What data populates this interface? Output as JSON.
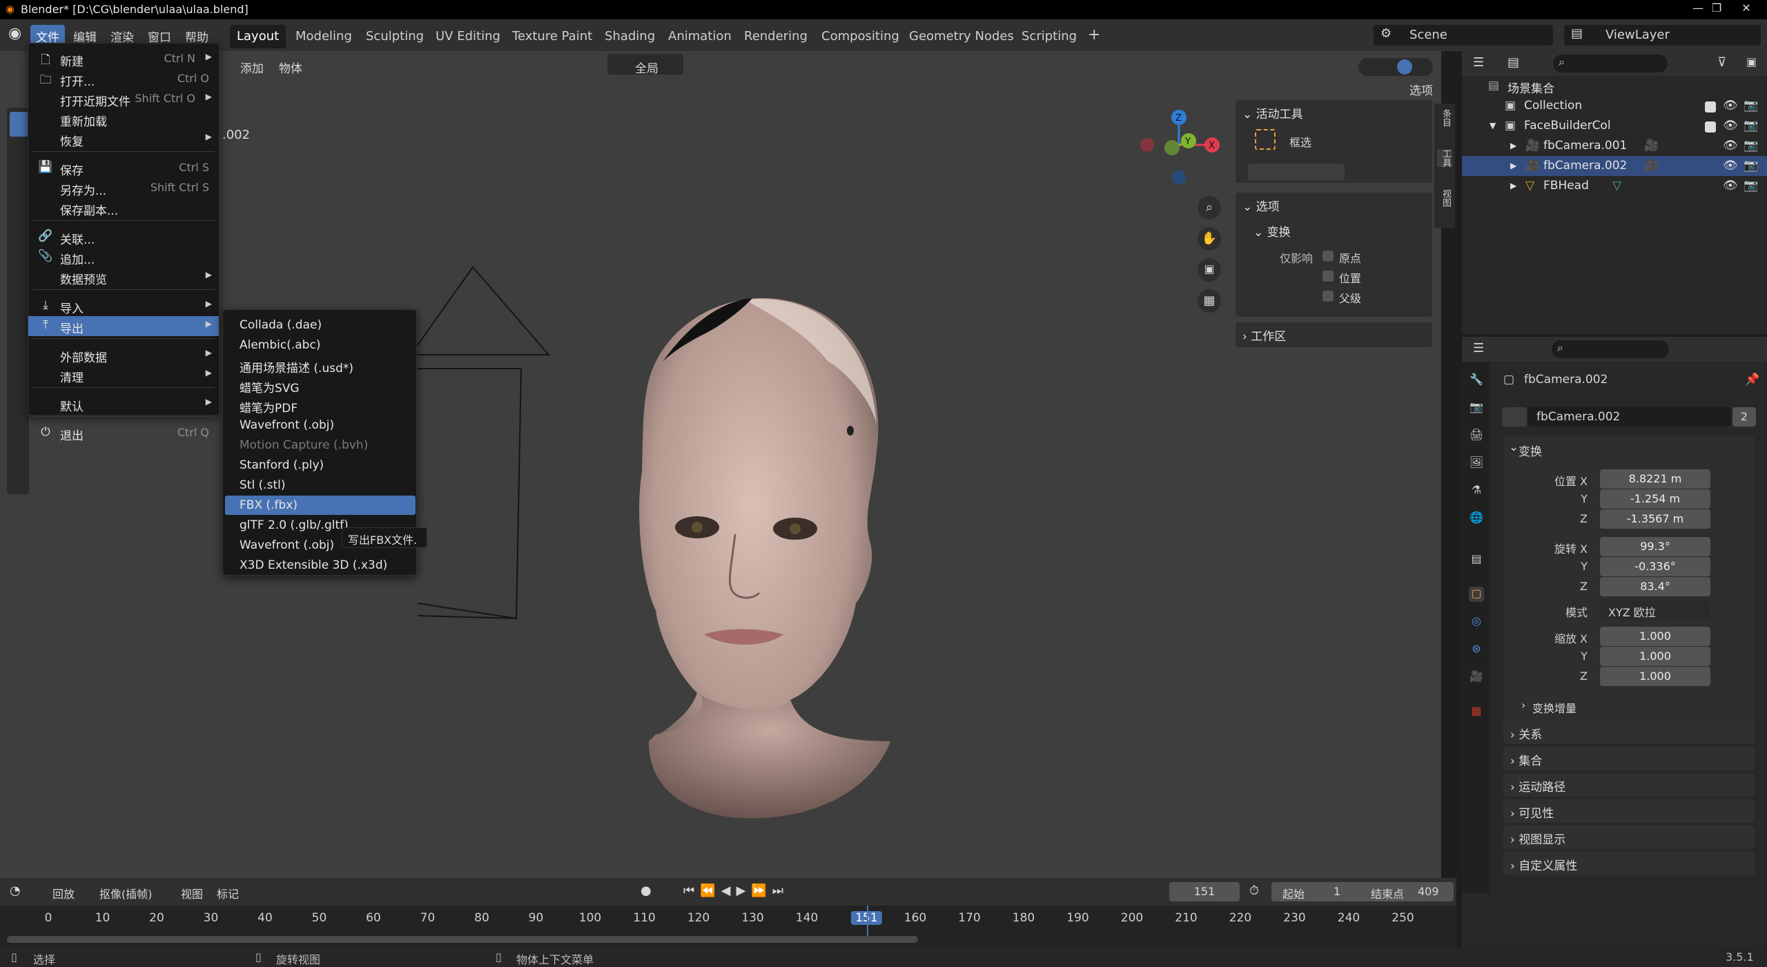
{
  "window": {
    "title": "Blender* [D:\\CG\\blender\\ulaa\\ulaa.blend]",
    "minimize": "—",
    "maximize": "❐",
    "close": "✕"
  },
  "topmenu": [
    "文件",
    "编辑",
    "渲染",
    "窗口",
    "帮助"
  ],
  "workspaces": [
    "Layout",
    "Modeling",
    "Sculpting",
    "UV Editing",
    "Texture Paint",
    "Shading",
    "Animation",
    "Rendering",
    "Compositing",
    "Geometry Nodes",
    "Scripting"
  ],
  "add_workspace": "+",
  "scene": {
    "label": "Scene",
    "viewlayer": "ViewLayer"
  },
  "viewport_header": {
    "add": "添加",
    "object": "物体",
    "transform_orient": "全局",
    "options": "选项",
    "object_label": ".002"
  },
  "gizmo": {
    "z": "Z",
    "y": "Y",
    "x": "X"
  },
  "file_menu": [
    {
      "label": "新建",
      "shortcut": "Ctrl N",
      "icon": "new-file-icon",
      "submenu": true
    },
    {
      "label": "打开...",
      "shortcut": "Ctrl O",
      "icon": "folder-icon"
    },
    {
      "label": "打开近期文件",
      "shortcut": "Shift Ctrl O",
      "icon": "",
      "submenu": true
    },
    {
      "label": "重新加载",
      "shortcut": "",
      "icon": ""
    },
    {
      "label": "恢复",
      "shortcut": "",
      "icon": "",
      "submenu": true
    },
    {
      "label": "保存",
      "shortcut": "Ctrl S",
      "icon": "save-icon"
    },
    {
      "label": "另存为...",
      "shortcut": "Shift Ctrl S",
      "icon": ""
    },
    {
      "label": "保存副本...",
      "shortcut": "",
      "icon": ""
    },
    {
      "label": "关联...",
      "shortcut": "",
      "icon": "link-icon"
    },
    {
      "label": "追加...",
      "shortcut": "",
      "icon": "append-icon"
    },
    {
      "label": "数据预览",
      "shortcut": "",
      "icon": "",
      "submenu": true
    },
    {
      "label": "导入",
      "shortcut": "",
      "icon": "import-icon",
      "submenu": true
    },
    {
      "label": "导出",
      "shortcut": "",
      "icon": "export-icon",
      "submenu": true
    },
    {
      "label": "外部数据",
      "shortcut": "",
      "icon": "",
      "submenu": true
    },
    {
      "label": "清理",
      "shortcut": "",
      "icon": "",
      "submenu": true
    },
    {
      "label": "默认",
      "shortcut": "",
      "icon": "",
      "submenu": true
    },
    {
      "label": "退出",
      "shortcut": "Ctrl Q",
      "icon": "power-icon"
    }
  ],
  "export_menu": [
    "Collada (.dae)",
    "Alembic(.abc)",
    "通用场景描述 (.usd*)",
    "蜡笔为SVG",
    "蜡笔为PDF",
    "Wavefront (.obj)",
    "Motion Capture (.bvh)",
    "Stanford (.ply)",
    "Stl (.stl)",
    "FBX (.fbx)",
    "glTF 2.0 (.glb/.gltf)",
    "Wavefront (.obj)",
    "X3D Extensible 3D (.x3d)"
  ],
  "tooltip": "写出FBX文件.",
  "npanel": {
    "active_tool": "活动工具",
    "tool_name": "框选",
    "options": "选项",
    "transform": "变换",
    "affect_only": "仅影响",
    "origins": "原点",
    "locations": "位置",
    "parents": "父级",
    "workspace": "工作区",
    "tabs": [
      "条目",
      "工具",
      "视图"
    ]
  },
  "outliner": {
    "scene_collection": "场景集合",
    "rows": [
      "Collection",
      "FaceBuilderCol",
      "fbCamera.001",
      "fbCamera.002",
      "FBHead"
    ]
  },
  "properties": {
    "object_name": "fbCamera.002",
    "data_name": "fbCamera.002",
    "users": "2",
    "transform": "变换",
    "location_label": "位置 X",
    "rotation_label": "旋转 X",
    "mode_label": "模式",
    "scale_label": "缩放 X",
    "y": "Y",
    "z": "Z",
    "location": [
      "8.8221 m",
      "-1.254 m",
      "-1.3567 m"
    ],
    "rotation": [
      "99.3°",
      "-0.336°",
      "83.4°"
    ],
    "mode": "XYZ 欧拉",
    "scale": [
      "1.000",
      "1.000",
      "1.000"
    ],
    "delta": "变换增量",
    "sections": [
      "关系",
      "集合",
      "运动路径",
      "可见性",
      "视图显示",
      "自定义属性"
    ]
  },
  "timeline": {
    "playback": "回放",
    "keying": "抠像(插帧)",
    "view": "视图",
    "marker": "标记",
    "current_frame": "151",
    "start_label": "起始",
    "start": "1",
    "end_label": "结束点",
    "end": "409",
    "ticks": [
      "0",
      "10",
      "20",
      "30",
      "40",
      "50",
      "60",
      "70",
      "80",
      "90",
      "100",
      "110",
      "120",
      "130",
      "140",
      "151",
      "160",
      "170",
      "180",
      "190",
      "200",
      "210",
      "220",
      "230",
      "240",
      "250"
    ]
  },
  "statusbar": {
    "select": "选择",
    "rotate": "旋转视图",
    "context": "物体上下文菜单",
    "version": "3.5.1"
  }
}
